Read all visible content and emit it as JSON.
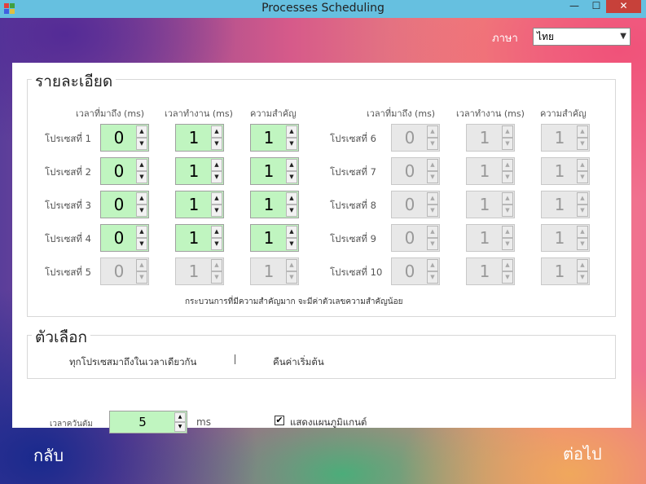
{
  "window": {
    "title": "Processes Scheduling",
    "minimize": "—",
    "maximize": "☐",
    "close": "✕"
  },
  "language": {
    "label": "ภาษา",
    "selected": "ไทย"
  },
  "details": {
    "title": "รายละเอียด",
    "headers": {
      "arrival": "เวลาที่มาถึง (ms)",
      "burst": "เวลาทำงาน (ms)",
      "priority": "ความสำคัญ"
    },
    "processes": [
      {
        "label": "โปรเซสที่ 1",
        "arrival": "0",
        "burst": "1",
        "priority": "1",
        "enabled": true
      },
      {
        "label": "โปรเซสที่ 2",
        "arrival": "0",
        "burst": "1",
        "priority": "1",
        "enabled": true
      },
      {
        "label": "โปรเซสที่ 3",
        "arrival": "0",
        "burst": "1",
        "priority": "1",
        "enabled": true
      },
      {
        "label": "โปรเซสที่ 4",
        "arrival": "0",
        "burst": "1",
        "priority": "1",
        "enabled": true
      },
      {
        "label": "โปรเซสที่ 5",
        "arrival": "0",
        "burst": "1",
        "priority": "1",
        "enabled": false
      },
      {
        "label": "โปรเซสที่ 6",
        "arrival": "0",
        "burst": "1",
        "priority": "1",
        "enabled": false
      },
      {
        "label": "โปรเซสที่ 7",
        "arrival": "0",
        "burst": "1",
        "priority": "1",
        "enabled": false
      },
      {
        "label": "โปรเซสที่ 8",
        "arrival": "0",
        "burst": "1",
        "priority": "1",
        "enabled": false
      },
      {
        "label": "โปรเซสที่ 9",
        "arrival": "0",
        "burst": "1",
        "priority": "1",
        "enabled": false
      },
      {
        "label": "โปรเซสที่ 10",
        "arrival": "0",
        "burst": "1",
        "priority": "1",
        "enabled": false
      }
    ],
    "note": "กระบวนการที่มีความสำคัญมาก จะมีค่าตัวเลขความสำคัญน้อย"
  },
  "options": {
    "title": "ตัวเลือก",
    "same_arrival": "ทุกโปรเซสมาถึงในเวลาเดียวกัน",
    "reset": "คืนค่าเริ่มต้น"
  },
  "timing": {
    "label": "เวลาควันตัม",
    "value": "5",
    "unit": "ms"
  },
  "gantt": {
    "label": "แสดงแผนภูมิแกนต์",
    "checked": true,
    "check_mark": "✔"
  },
  "nav": {
    "back": "กลับ",
    "next": "ต่อไป"
  },
  "spin_glyphs": {
    "up": "▲",
    "down": "▼"
  },
  "colors": {
    "enabled_field": "#c0f5c0",
    "disabled_field": "#e8e8e8",
    "titlebar": "#66c0e0",
    "close": "#c7413a"
  }
}
